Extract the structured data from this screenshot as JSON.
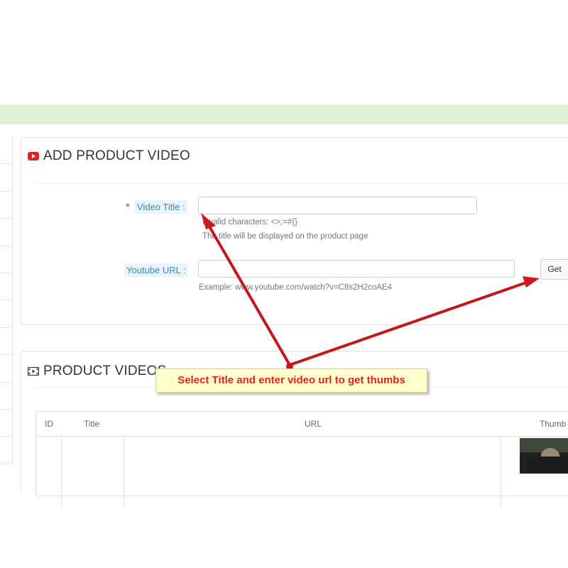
{
  "add_panel": {
    "title": "ADD PRODUCT VIDEO",
    "icon": "youtube-icon",
    "video_title": {
      "required_mark": "*",
      "label": "Video Title :",
      "value": "",
      "help_invalid": "Invalid characters: <>;=#{}",
      "help_display": "The title will be displayed on the product page"
    },
    "youtube_url": {
      "label": "Youtube URL :",
      "value": "",
      "example": "Example: www.youtube.com/watch?v=C8s2H2coAE4",
      "get_button": "Get"
    }
  },
  "list_panel": {
    "title": "PRODUCT VIDEOS",
    "icon": "film-icon",
    "columns": [
      "ID",
      "Title",
      "URL",
      "Thumb"
    ]
  },
  "callout": {
    "text": "Select Title and enter video url to get thumbs"
  },
  "colors": {
    "green_bar": "#dff0d8",
    "arrow_red": "#e0151e",
    "callout_bg": "#ffffcc",
    "callout_text": "#e0202a",
    "label_blue": "#3a8aa9"
  }
}
